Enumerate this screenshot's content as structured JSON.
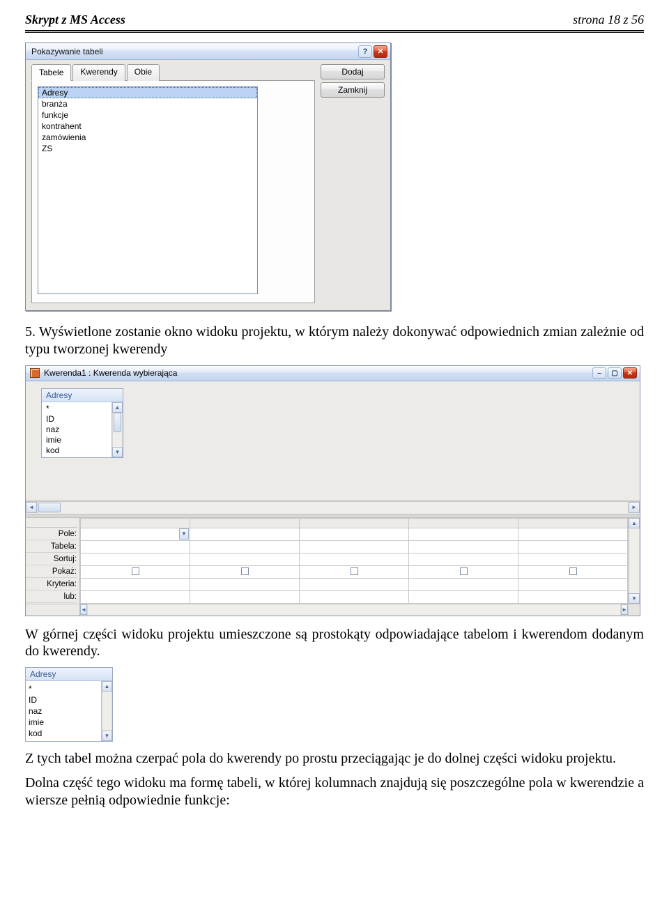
{
  "header": {
    "left": "Skrypt z MS  Access",
    "right_prefix": "strona ",
    "right_page": "18",
    "right_suffix": " z 56"
  },
  "dialog": {
    "title": "Pokazywanie tabeli",
    "help_glyph": "?",
    "close_glyph": "✕",
    "tabs": [
      "Tabele",
      "Kwerendy",
      "Obie"
    ],
    "active_tab": 0,
    "list_items": [
      "Adresy",
      "branża",
      "funkcje",
      "kontrahent",
      "zamówienia",
      "ZS"
    ],
    "selected_index": 0,
    "btn_add": "Dodaj",
    "btn_close": "Zamknij"
  },
  "para1": "5. Wyświetlone zostanie okno widoku projektu, w którym należy dokonywać odpowiednich zmian zależnie od typu tworzonej kwerendy",
  "kwerenda": {
    "title": "Kwerenda1 : Kwerenda wybierająca",
    "min_glyph": "–",
    "max_glyph": "▢",
    "close_glyph": "✕",
    "fieldbox": {
      "title": "Adresy",
      "items": [
        "*",
        "ID",
        "naz",
        "imie",
        "kod"
      ]
    },
    "grid_labels": [
      "Pole:",
      "Tabela:",
      "Sortuj:",
      "Pokaż:",
      "Kryteria:",
      "lub:"
    ]
  },
  "para2": "W górnej części widoku projektu umieszczone są prostokąty odpowiadające tabelom i kwerendom dodanym do kwerendy.",
  "smallbox": {
    "title": "Adresy",
    "items": [
      "*",
      "ID",
      "naz",
      "imie",
      "kod"
    ]
  },
  "para3": "Z tych tabel można czerpać pola do kwerendy po prostu przeciągając je do dolnej części widoku projektu.",
  "para4": "Dolna część tego widoku ma formę tabeli, w której kolumnach znajdują się poszczególne pola w kwerendzie a wiersze pełnią odpowiednie funkcje:"
}
